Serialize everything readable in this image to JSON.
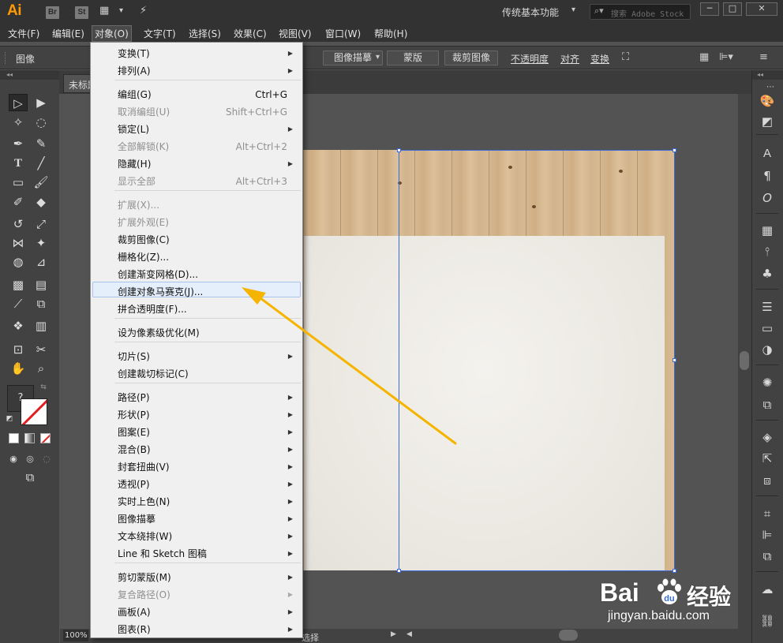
{
  "app": {
    "logo": "Ai",
    "bridge": "Br",
    "stock": "St",
    "workspace": "传统基本功能",
    "search_placeholder": "搜索 Adobe Stock"
  },
  "menubar": [
    "文件(F)",
    "编辑(E)",
    "对象(O)",
    "文字(T)",
    "选择(S)",
    "效果(C)",
    "视图(V)",
    "窗口(W)",
    "帮助(H)"
  ],
  "controlbar": {
    "label": "图像",
    "image_trace": "图像描摹",
    "mask": "蒙版",
    "crop_image": "裁剪图像",
    "opacity": "不透明度",
    "align": "对齐",
    "transform": "变换"
  },
  "document": {
    "tab_title": "未标题",
    "zoom": "100%",
    "status": "选择"
  },
  "object_menu": {
    "items": [
      {
        "label": "变换(T)",
        "shortcut": "",
        "submenu": true,
        "disabled": false
      },
      {
        "label": "排列(A)",
        "shortcut": "",
        "submenu": true,
        "disabled": false
      },
      {
        "label": "编组(G)",
        "shortcut": "Ctrl+G",
        "submenu": false,
        "disabled": false
      },
      {
        "label": "取消编组(U)",
        "shortcut": "Shift+Ctrl+G",
        "submenu": false,
        "disabled": true
      },
      {
        "label": "锁定(L)",
        "shortcut": "",
        "submenu": true,
        "disabled": false
      },
      {
        "label": "全部解锁(K)",
        "shortcut": "Alt+Ctrl+2",
        "submenu": false,
        "disabled": true
      },
      {
        "label": "隐藏(H)",
        "shortcut": "",
        "submenu": true,
        "disabled": false
      },
      {
        "label": "显示全部",
        "shortcut": "Alt+Ctrl+3",
        "submenu": false,
        "disabled": true
      },
      {
        "label": "扩展(X)...",
        "shortcut": "",
        "submenu": false,
        "disabled": true
      },
      {
        "label": "扩展外观(E)",
        "shortcut": "",
        "submenu": false,
        "disabled": true
      },
      {
        "label": "裁剪图像(C)",
        "shortcut": "",
        "submenu": false,
        "disabled": false
      },
      {
        "label": "栅格化(Z)...",
        "shortcut": "",
        "submenu": false,
        "disabled": false
      },
      {
        "label": "创建渐变网格(D)...",
        "shortcut": "",
        "submenu": false,
        "disabled": false
      },
      {
        "label": "创建对象马赛克(J)...",
        "shortcut": "",
        "submenu": false,
        "disabled": false,
        "highlighted": true
      },
      {
        "label": "拼合透明度(F)...",
        "shortcut": "",
        "submenu": false,
        "disabled": false
      },
      {
        "label": "设为像素级优化(M)",
        "shortcut": "",
        "submenu": false,
        "disabled": false
      },
      {
        "label": "切片(S)",
        "shortcut": "",
        "submenu": true,
        "disabled": false
      },
      {
        "label": "创建裁切标记(C)",
        "shortcut": "",
        "submenu": false,
        "disabled": false
      },
      {
        "label": "路径(P)",
        "shortcut": "",
        "submenu": true,
        "disabled": false
      },
      {
        "label": "形状(P)",
        "shortcut": "",
        "submenu": true,
        "disabled": false
      },
      {
        "label": "图案(E)",
        "shortcut": "",
        "submenu": true,
        "disabled": false
      },
      {
        "label": "混合(B)",
        "shortcut": "",
        "submenu": true,
        "disabled": false
      },
      {
        "label": "封套扭曲(V)",
        "shortcut": "",
        "submenu": true,
        "disabled": false
      },
      {
        "label": "透视(P)",
        "shortcut": "",
        "submenu": true,
        "disabled": false
      },
      {
        "label": "实时上色(N)",
        "shortcut": "",
        "submenu": true,
        "disabled": false
      },
      {
        "label": "图像描摹",
        "shortcut": "",
        "submenu": true,
        "disabled": false
      },
      {
        "label": "文本绕排(W)",
        "shortcut": "",
        "submenu": true,
        "disabled": false
      },
      {
        "label": "Line 和 Sketch 图稿",
        "shortcut": "",
        "submenu": true,
        "disabled": false
      },
      {
        "label": "剪切蒙版(M)",
        "shortcut": "",
        "submenu": true,
        "disabled": false
      },
      {
        "label": "复合路径(O)",
        "shortcut": "",
        "submenu": true,
        "disabled": true
      },
      {
        "label": "画板(A)",
        "shortcut": "",
        "submenu": true,
        "disabled": false
      },
      {
        "label": "图表(R)",
        "shortcut": "",
        "submenu": true,
        "disabled": false
      }
    ]
  },
  "watermark": {
    "brand": "Bai",
    "brand_cn": "经验",
    "url": "jingyan.baidu.com"
  },
  "colors": {
    "accent_orange": "#ff9a00",
    "arrow": "#f5b400",
    "selection": "#3a6bd8",
    "menu_highlight": "#e5eefb"
  }
}
